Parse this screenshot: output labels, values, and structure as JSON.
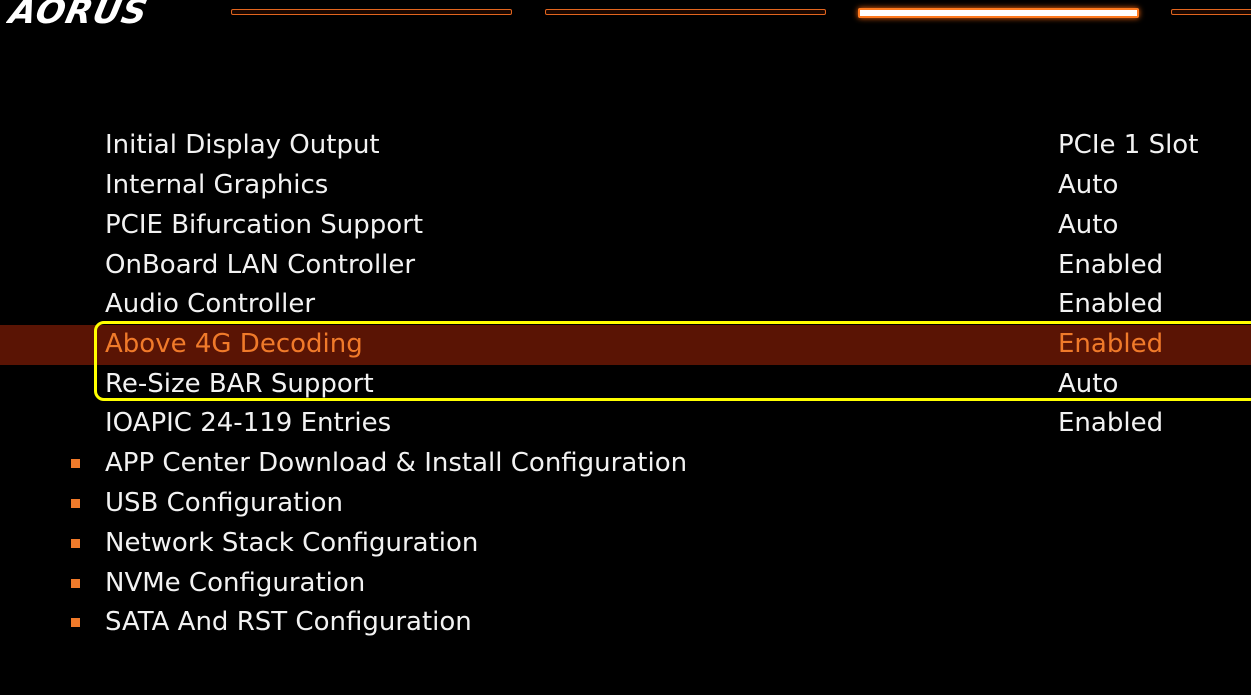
{
  "header": {
    "logo_text": "AORUS"
  },
  "settings": [
    {
      "label": "Initial Display Output",
      "value": "PCIe 1 Slot"
    },
    {
      "label": "Internal Graphics",
      "value": "Auto"
    },
    {
      "label": "PCIE Bifurcation Support",
      "value": "Auto"
    },
    {
      "label": "OnBoard LAN Controller",
      "value": "Enabled"
    },
    {
      "label": "Audio Controller",
      "value": "Enabled"
    },
    {
      "label": "Above 4G Decoding",
      "value": "Enabled",
      "selected": true
    },
    {
      "label": "Re-Size BAR Support",
      "value": "Auto"
    },
    {
      "label": "IOAPIC 24-119 Entries",
      "value": "Enabled"
    }
  ],
  "submenus": [
    {
      "label": "APP Center Download & Install Configuration"
    },
    {
      "label": "USB Configuration"
    },
    {
      "label": "Network Stack Configuration"
    },
    {
      "label": "NVMe Configuration"
    },
    {
      "label": "SATA And RST Configuration"
    }
  ],
  "colors": {
    "background": "#000000",
    "accent": "#f07a2a",
    "selected_row": "#5a1404",
    "annotation_box": "#ffff00"
  }
}
